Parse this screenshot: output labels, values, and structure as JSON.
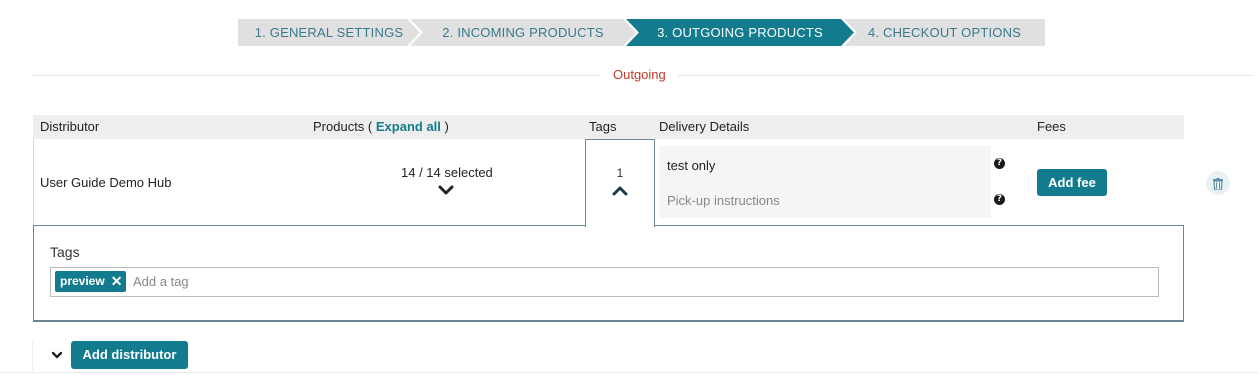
{
  "wizard": {
    "steps": [
      {
        "label": "1. GENERAL SETTINGS"
      },
      {
        "label": "2. INCOMING PRODUCTS"
      },
      {
        "label": "3. OUTGOING PRODUCTS"
      },
      {
        "label": "4. CHECKOUT OPTIONS"
      }
    ],
    "active_index": 2
  },
  "section": {
    "title": "Outgoing"
  },
  "table": {
    "headers": {
      "distributor": "Distributor",
      "products": "Products (",
      "expand_all": "Expand all",
      "products_close": ")",
      "tags": "Tags",
      "delivery": "Delivery Details",
      "fees": "Fees"
    },
    "row": {
      "distributor": "User Guide Demo Hub",
      "products_selected": "14 / 14 selected",
      "tags_count": "1",
      "delivery_note": "test only",
      "pickup_placeholder": "Pick-up instructions",
      "add_fee_label": "Add fee"
    }
  },
  "tags_panel": {
    "label": "Tags",
    "chips": [
      {
        "label": "preview",
        "remove": "✕"
      }
    ],
    "placeholder": "Add a tag"
  },
  "footer": {
    "add_distributor_label": "Add distributor"
  },
  "colors": {
    "accent": "#137b8e",
    "section_title": "#c0392b",
    "step_inactive": "#e0e0e0"
  },
  "icons": [
    "chevron-down-icon",
    "chevron-up-icon",
    "help-icon",
    "trash-icon",
    "remove-tag-icon"
  ]
}
